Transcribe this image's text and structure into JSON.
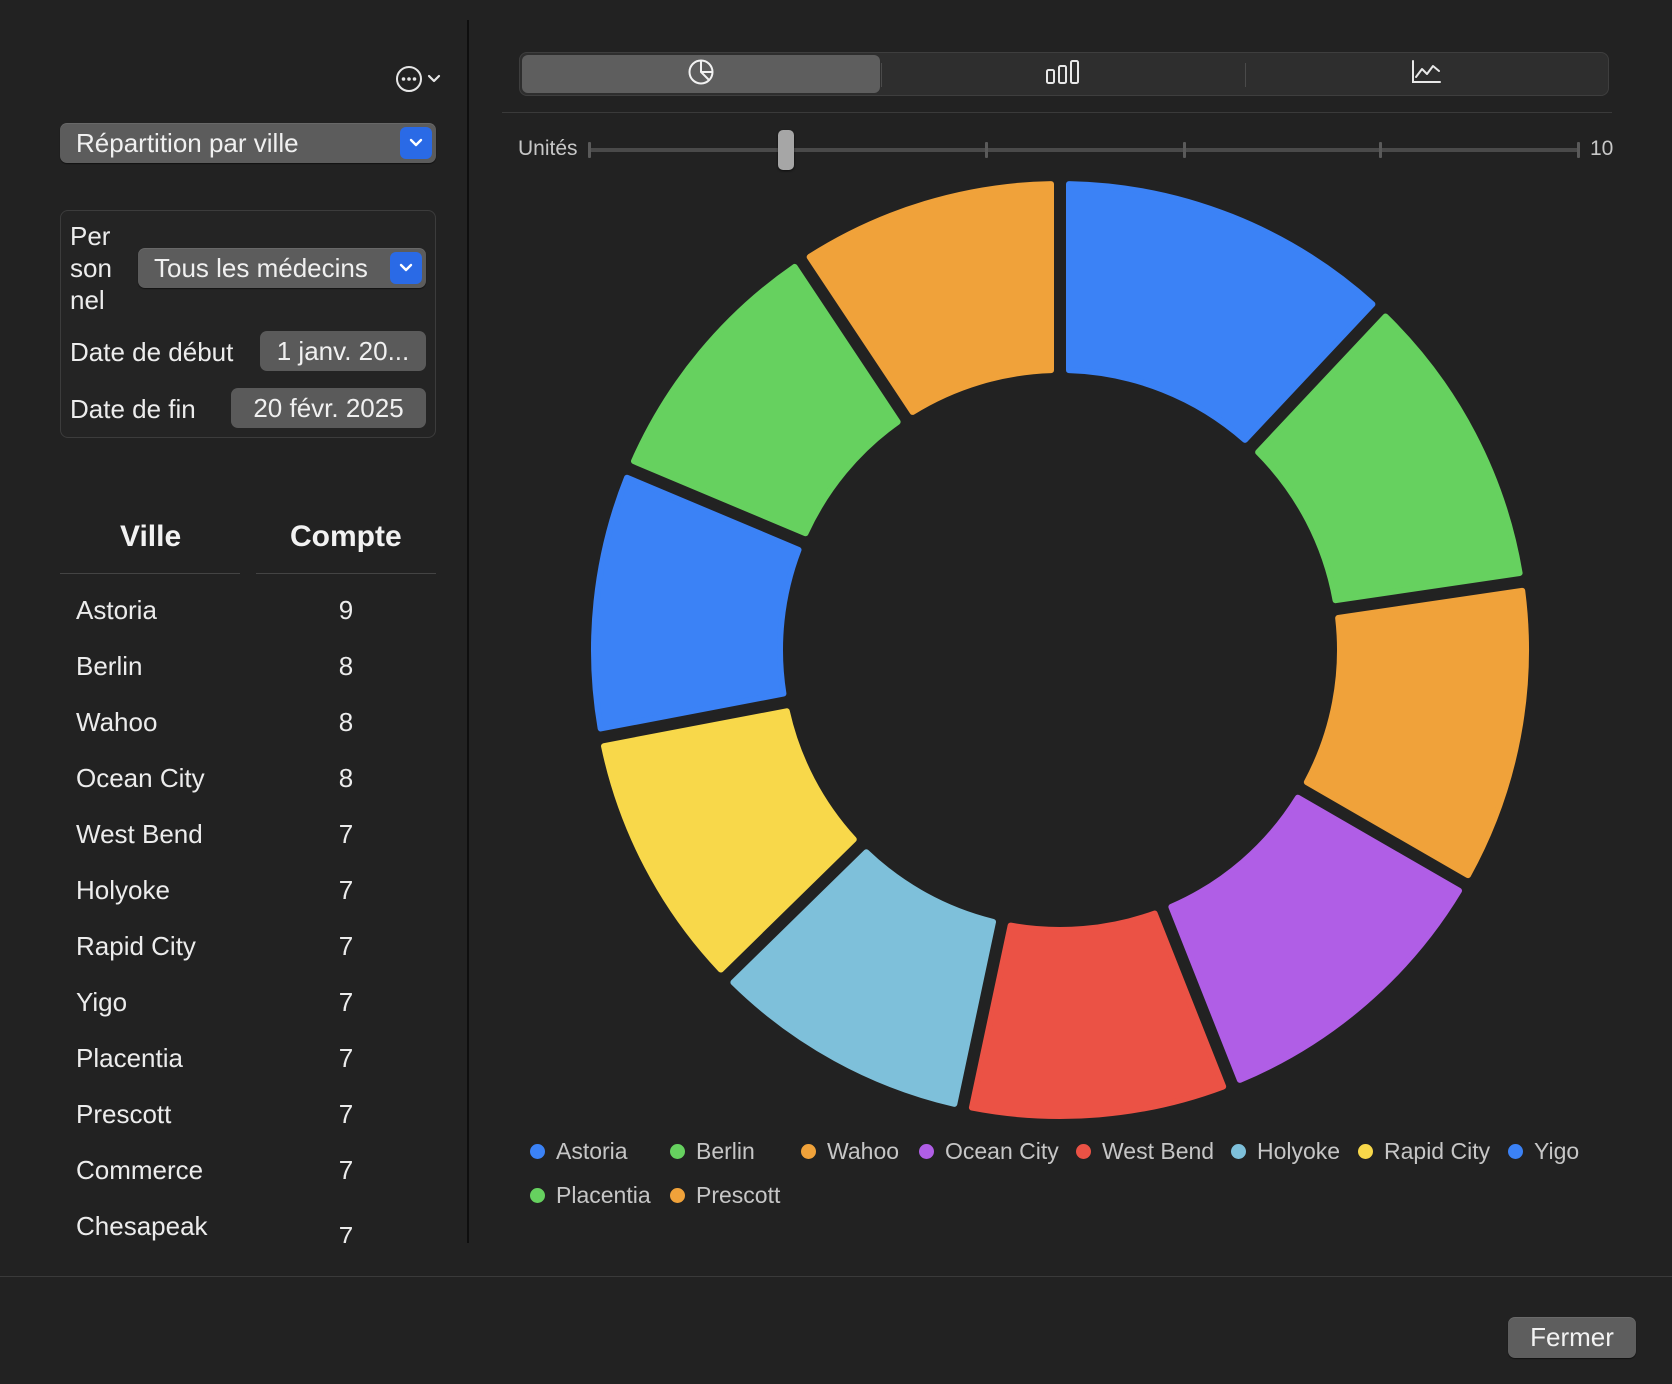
{
  "toolbar": {
    "more_icon": "ellipsis-circle-icon"
  },
  "report": {
    "selected": "Répartition par ville"
  },
  "filters": {
    "staff_label": "Per son nel",
    "staff_value": "Tous les médecins",
    "start_label": "Date de début",
    "start_value": "1 janv. 20...",
    "end_label": "Date de fin",
    "end_value": "20 févr. 2025"
  },
  "table": {
    "headers": {
      "city": "Ville",
      "count": "Compte"
    },
    "rows": [
      {
        "city": "Astoria",
        "count": "9"
      },
      {
        "city": "Berlin",
        "count": "8"
      },
      {
        "city": "Wahoo",
        "count": "8"
      },
      {
        "city": "Ocean City",
        "count": "8"
      },
      {
        "city": "West Bend",
        "count": "7"
      },
      {
        "city": "Holyoke",
        "count": "7"
      },
      {
        "city": "Rapid City",
        "count": "7"
      },
      {
        "city": "Yigo",
        "count": "7"
      },
      {
        "city": "Placentia",
        "count": "7"
      },
      {
        "city": "Prescott",
        "count": "7"
      },
      {
        "city": "Commerce",
        "count": "7"
      },
      {
        "city": "Chesapeak",
        "count": "7"
      }
    ]
  },
  "chart_types": {
    "active": "pie",
    "items": [
      {
        "id": "pie",
        "icon": "pie-chart-icon"
      },
      {
        "id": "bar",
        "icon": "bar-chart-icon"
      },
      {
        "id": "line",
        "icon": "line-chart-icon"
      }
    ]
  },
  "slider": {
    "label": "Unités",
    "max_label": "10",
    "value_fraction": 0.2
  },
  "chart_data": {
    "type": "pie",
    "donut": true,
    "slices": [
      {
        "label": "Astoria",
        "value": 9,
        "color": "#3b82f6"
      },
      {
        "label": "Berlin",
        "value": 8,
        "color": "#66d15f"
      },
      {
        "label": "Wahoo",
        "value": 8,
        "color": "#f0a23a"
      },
      {
        "label": "Ocean City",
        "value": 8,
        "color": "#b05ee6"
      },
      {
        "label": "West Bend",
        "value": 7,
        "color": "#eb5245"
      },
      {
        "label": "Holyoke",
        "value": 7,
        "color": "#7ec0da"
      },
      {
        "label": "Rapid City",
        "value": 7,
        "color": "#f8d84a"
      },
      {
        "label": "Yigo",
        "value": 7,
        "color": "#3b82f6"
      },
      {
        "label": "Placentia",
        "value": 7,
        "color": "#66d15f"
      },
      {
        "label": "Prescott",
        "value": 7,
        "color": "#f0a23a"
      }
    ],
    "legend_position": "bottom"
  },
  "footer": {
    "close_label": "Fermer"
  }
}
